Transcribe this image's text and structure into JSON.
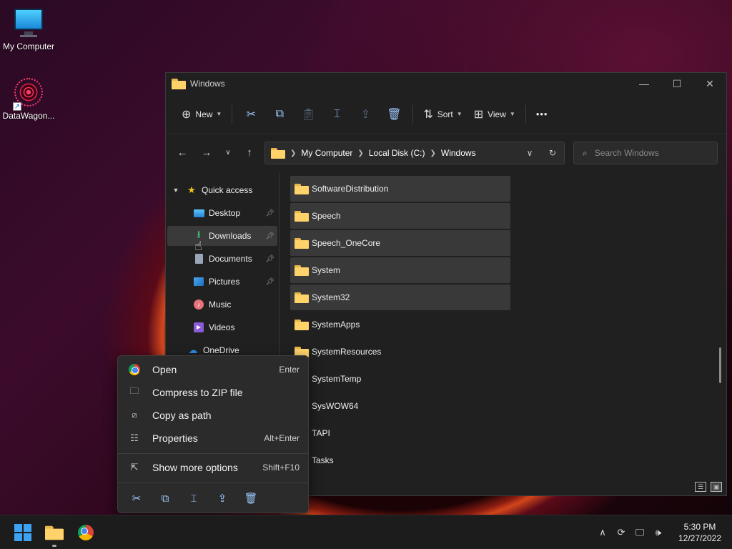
{
  "desktop": {
    "icons": [
      {
        "label": "My Computer",
        "icon": "computer-icon"
      },
      {
        "label": "DataWagon...",
        "icon": "datawagon-shortcut-icon"
      }
    ]
  },
  "window": {
    "title": "Windows",
    "controls": {
      "minimize": "—",
      "maximize": "☐",
      "close": "✕"
    }
  },
  "toolbar": {
    "new_label": "New",
    "sort_label": "Sort",
    "view_label": "View",
    "more_label": "•••"
  },
  "address": {
    "crumbs": [
      "My Computer",
      "Local Disk (C:)",
      "Windows"
    ]
  },
  "search": {
    "placeholder": "Search Windows"
  },
  "sidebar": {
    "items": [
      {
        "label": "Quick access",
        "icon": "star-icon"
      },
      {
        "label": "Desktop",
        "icon": "desktop-icon",
        "pinned": true
      },
      {
        "label": "Downloads",
        "icon": "download-icon",
        "pinned": true,
        "selected": true
      },
      {
        "label": "Documents",
        "icon": "document-icon",
        "pinned": true
      },
      {
        "label": "Pictures",
        "icon": "pictures-icon",
        "pinned": true
      },
      {
        "label": "Music",
        "icon": "music-icon"
      },
      {
        "label": "Videos",
        "icon": "videos-icon"
      },
      {
        "label": "OneDrive",
        "icon": "onedrive-icon"
      }
    ]
  },
  "files": [
    "SoftwareDistribution",
    "Speech",
    "Speech_OneCore",
    "System",
    "System32",
    "SystemApps",
    "SystemResources",
    "SystemTemp",
    "SysWOW64",
    "TAPI",
    "Tasks"
  ],
  "context_menu": {
    "items": [
      {
        "label": "Open",
        "shortcut": "Enter",
        "icon": "chrome-icon"
      },
      {
        "label": "Compress to ZIP file",
        "shortcut": "",
        "icon": "zip-icon"
      },
      {
        "label": "Copy as path",
        "shortcut": "",
        "icon": "copy-path-icon"
      },
      {
        "label": "Properties",
        "shortcut": "Alt+Enter",
        "icon": "properties-icon"
      },
      {
        "label": "Show more options",
        "shortcut": "Shift+F10",
        "icon": "more-options-icon"
      }
    ]
  },
  "taskbar": {
    "time": "5:30 PM",
    "date": "12/27/2022"
  }
}
